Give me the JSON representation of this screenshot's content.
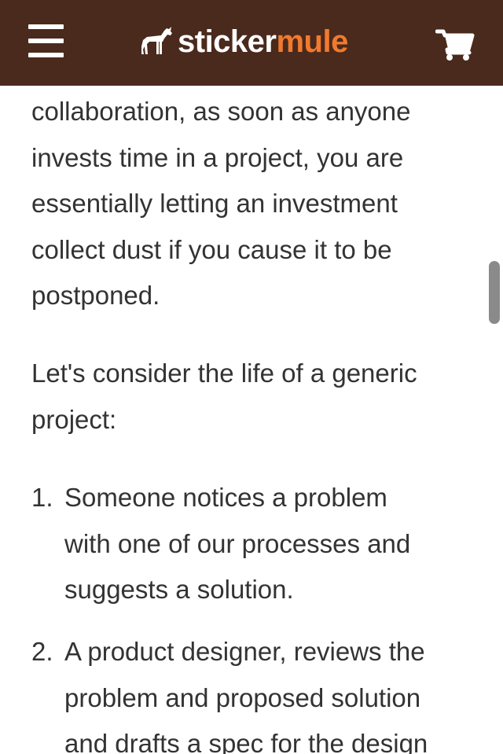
{
  "header": {
    "menu_icon": "hamburger-menu-icon",
    "logo": {
      "icon": "mule-icon",
      "word_first": "sticker",
      "word_second": "mule"
    },
    "cart_icon": "shopping-cart-icon"
  },
  "article": {
    "paragraph_1": [
      "collaboration, as soon as anyone",
      "invests time in a project, you are",
      "essentially letting an investment",
      "collect dust if you cause it to be",
      "postponed."
    ],
    "paragraph_2": [
      "Let's consider the life of a generic",
      "project:"
    ],
    "list": [
      {
        "number": "1.",
        "lines": [
          "Someone notices a problem",
          "with one of our processes and",
          "suggests a solution."
        ]
      },
      {
        "number": "2.",
        "lines": [
          "A product designer, reviews the",
          "problem and proposed solution",
          "and drafts a spec for the design"
        ]
      }
    ]
  },
  "colors": {
    "header_bg": "#4a2a1c",
    "logo_accent": "#f07a2f",
    "text": "#333333"
  }
}
